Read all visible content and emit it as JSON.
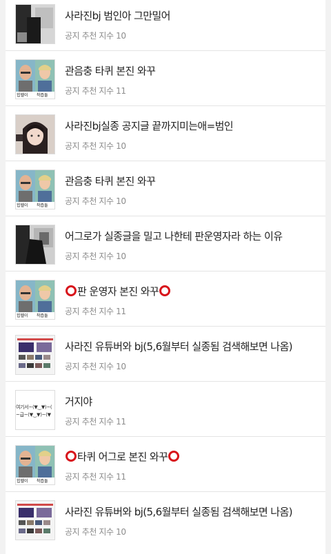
{
  "posts": [
    {
      "title": "사라진bj 범인아 그만밀어",
      "meta": "공지 추천 지수 10",
      "thumb": "dark-room-photo"
    },
    {
      "title": "관음충 타퀴 본진 와꾸",
      "meta": "공지 추천 지수 11",
      "thumb": "two-avatars-hiphop"
    },
    {
      "title": "사라진bj실종 공지글 끝까지미는애=범인",
      "meta": "공지 추천 지수 10",
      "thumb": "girl-selfie-photo"
    },
    {
      "title": "관음충 타퀴 본진 와꾸",
      "meta": "공지 추천 지수 10",
      "thumb": "two-avatars-hiphop"
    },
    {
      "title": "어그로가 실종글을 밀고 나한테 판운영자라 하는 이유",
      "meta": "공지 추천 지수 10",
      "thumb": "dark-room-photo"
    },
    {
      "title": "판 운영자 본진 와꾸",
      "meta": "공지 추천 지수 11",
      "thumb": "two-avatars-hiphop",
      "rings": true
    },
    {
      "title": "사라진 유튜버와 bj(5,6월부터 실종됨 검색해보면 나옴)",
      "meta": "공지 추천 지수 10",
      "thumb": "video-list-screenshot"
    },
    {
      "title": "거지야",
      "meta": "공지 추천 지수 11",
      "thumb": "emoticon-text",
      "thumb_text": [
        "여기서~(▼‿▼)~(",
        "~급~(▼‿▼)~(▼"
      ]
    },
    {
      "title": "타퀴 어그로 본진 와꾸",
      "meta": "공지 추천 지수 11",
      "thumb": "two-avatars-hiphop",
      "rings": true
    },
    {
      "title": "사라진 유튜버와 bj(5,6월부터 실종됨 검색해보면 나옴)",
      "meta": "공지 추천 지수 10",
      "thumb": "video-list-screenshot"
    }
  ],
  "avatar_captions": {
    "left": "힙헬이",
    "right": "착즙둘"
  },
  "colors": {
    "ring": "#d8141b",
    "title": "#222222",
    "meta": "#8c8c8c"
  }
}
